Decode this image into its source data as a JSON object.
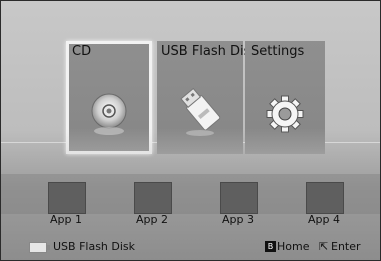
{
  "menu": {
    "tiles": [
      {
        "label": "CD",
        "icon": "disc-icon",
        "selected": true
      },
      {
        "label": "USB Flash Disk",
        "icon": "usb-drive-icon",
        "selected": false
      },
      {
        "label": "Settings",
        "icon": "gear-icon",
        "selected": false
      }
    ]
  },
  "apps": [
    {
      "label": "App 1"
    },
    {
      "label": "App 2"
    },
    {
      "label": "App 3"
    },
    {
      "label": "App 4"
    }
  ],
  "status": {
    "device_label": "USB Flash Disk",
    "home_key": "B",
    "home_label": "Home",
    "enter_icon": "⇱",
    "enter_label": "Enter"
  }
}
